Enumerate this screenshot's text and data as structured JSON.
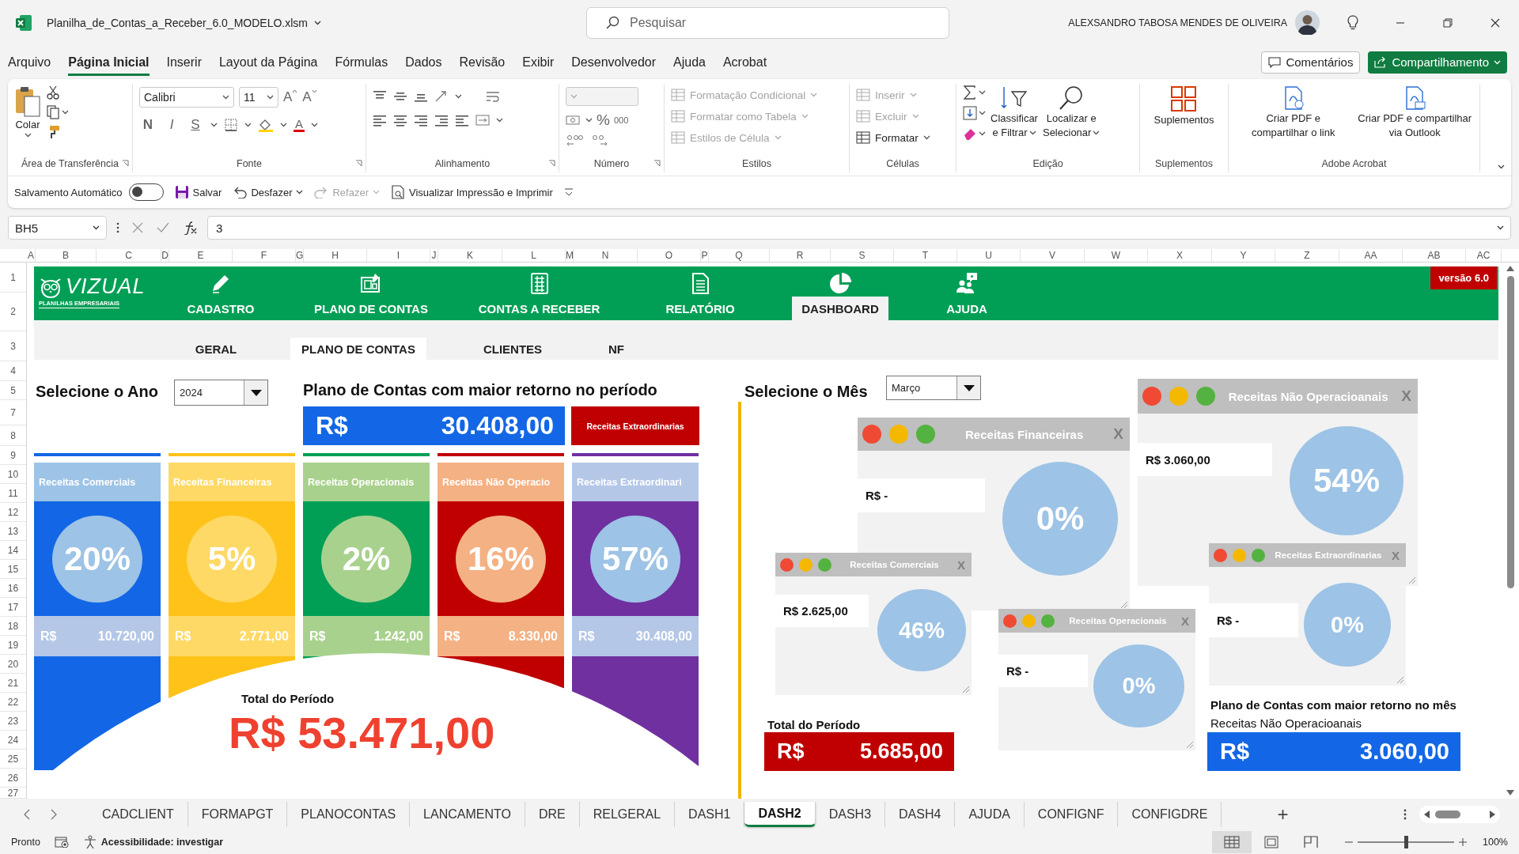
{
  "title_bar": {
    "filename": "Planilha_de_Contas_a_Receber_6.0_MODELO.xlsm",
    "search_placeholder": "Pesquisar",
    "user": "ALEXSANDRO TABOSA MENDES DE OLIVEIRA"
  },
  "menu": [
    {
      "label": "Arquivo",
      "selected": false
    },
    {
      "label": "Página Inicial",
      "selected": true
    },
    {
      "label": "Inserir",
      "selected": false
    },
    {
      "label": "Layout da Página",
      "selected": false
    },
    {
      "label": "Fórmulas",
      "selected": false
    },
    {
      "label": "Dados",
      "selected": false
    },
    {
      "label": "Revisão",
      "selected": false
    },
    {
      "label": "Exibir",
      "selected": false
    },
    {
      "label": "Desenvolvedor",
      "selected": false
    },
    {
      "label": "Ajuda",
      "selected": false
    },
    {
      "label": "Acrobat",
      "selected": false
    }
  ],
  "comments_button": "Comentários",
  "share_button": "Compartilhamento",
  "ribbon": [
    {
      "kind": "clipboard",
      "label": "Área de Transferência",
      "launcher": true,
      "paste": "Colar"
    },
    {
      "kind": "font",
      "label": "Fonte",
      "launcher": true,
      "font": "Calibri",
      "size": "11",
      "grow": "A",
      "shrink": "A",
      "styles": [
        "N",
        "I",
        "S"
      ],
      "color_letter": "A"
    },
    {
      "kind": "alignment",
      "label": "Alinhamento",
      "launcher": true
    },
    {
      "kind": "number",
      "label": "Número",
      "launcher": true,
      "percent": "%",
      "thousands": "000"
    },
    {
      "kind": "styles",
      "label": "Estilos",
      "launcher": false,
      "items": [
        {
          "label": "Formatação Condicional",
          "disabled": true
        },
        {
          "label": "Formatar como Tabela",
          "disabled": true
        },
        {
          "label": "Estilos de Célula",
          "disabled": true
        }
      ]
    },
    {
      "kind": "cells",
      "label": "Células",
      "launcher": false,
      "items": [
        {
          "label": "Inserir",
          "disabled": true
        },
        {
          "label": "Excluir",
          "disabled": true
        },
        {
          "label": "Formatar",
          "disabled": false
        }
      ]
    },
    {
      "kind": "editing",
      "label": "Edição",
      "launcher": false,
      "items": [
        {
          "lines": [
            "Classificar",
            "e Filtrar"
          ]
        },
        {
          "lines": [
            "Localizar e",
            "Selecionar"
          ]
        }
      ]
    },
    {
      "kind": "addins",
      "label": "Suplementos",
      "launcher": false,
      "items": [
        {
          "lines": [
            "Suplementos"
          ]
        }
      ]
    },
    {
      "kind": "acrobat",
      "label": "Adobe Acrobat",
      "launcher": false,
      "items": [
        {
          "lines": [
            "Criar PDF e",
            "compartilhar o link"
          ]
        },
        {
          "lines": [
            "Criar PDF e compartilhar",
            "via Outlook"
          ]
        }
      ]
    }
  ],
  "quick_access": {
    "autosave": {
      "label": "Salvamento Automático",
      "on": false
    },
    "items": [
      {
        "kind": "save",
        "label": "Salvar",
        "disabled": false
      },
      {
        "kind": "undo",
        "label": "Desfazer",
        "disabled": false
      },
      {
        "kind": "redo",
        "label": "Refazer",
        "disabled": true
      },
      {
        "kind": "print",
        "label": "Visualizar Impressão e Imprimir",
        "disabled": false
      }
    ]
  },
  "formula_bar": {
    "name_box": "BH5",
    "value": "3"
  },
  "columns": [
    "A",
    "B",
    "C",
    "D",
    "E",
    "F",
    "G",
    "H",
    "I",
    "J",
    "K",
    "L",
    "M",
    "N",
    "O",
    "P",
    "Q",
    "R",
    "S",
    "T",
    "U",
    "V",
    "W",
    "X",
    "Y",
    "Z",
    "AA",
    "AB",
    "AC"
  ],
  "rows": [
    "1",
    "2",
    "3",
    "4",
    "5",
    "7",
    "8",
    "9",
    "10",
    "11",
    "12",
    "13",
    "14",
    "15",
    "16",
    "17",
    "18",
    "19",
    "20",
    "21",
    "22",
    "23",
    "24",
    "25",
    "26",
    "27"
  ],
  "dashboard": {
    "logo": {
      "name": "VIZUAL",
      "tagline": "PLANILHAS EMPRESARIAIS"
    },
    "nav": [
      {
        "label": "CADASTRO",
        "kind": "pencil",
        "selected": false
      },
      {
        "label": "PLANO DE CONTAS",
        "kind": "blueprint",
        "selected": false
      },
      {
        "label": "CONTAS A RECEBER",
        "kind": "abacus",
        "selected": false
      },
      {
        "label": "RELATÓRIO",
        "kind": "document",
        "selected": false
      },
      {
        "label": "DASHBOARD",
        "kind": "pie",
        "selected": true
      },
      {
        "label": "AJUDA",
        "kind": "help",
        "selected": false
      }
    ],
    "version": "versão 6.0",
    "subtabs": [
      {
        "label": "GERAL",
        "selected": false
      },
      {
        "label": "PLANO DE CONTAS",
        "selected": true
      },
      {
        "label": "CLIENTES",
        "selected": false
      },
      {
        "label": "NF",
        "selected": false
      }
    ],
    "year": {
      "label": "Selecione o Ano",
      "value": "2024"
    },
    "top_account": {
      "title": "Plano de Contas com maior retorno no período",
      "currency": "R$",
      "amount": "30.408,00",
      "name": "Receitas Extraordinarias"
    },
    "cards": [
      {
        "title": "Receitas Comerciais",
        "percent": "20%",
        "currency": "R$",
        "amount": "10.720,00",
        "color": "#1367e6"
      },
      {
        "title": "Receitas Financeiras",
        "percent": "5%",
        "currency": "R$",
        "amount": "2.771,00",
        "color": "#fec219"
      },
      {
        "title": "Receitas Operacionais",
        "percent": "2%",
        "currency": "R$",
        "amount": "1.242,00",
        "color": "#009f55"
      },
      {
        "title": "Receitas Não Operacio",
        "percent": "16%",
        "currency": "R$",
        "amount": "8.330,00",
        "color": "#c00000"
      },
      {
        "title": "Receitas Extraordinari",
        "percent": "57%",
        "currency": "R$",
        "amount": "30.408,00",
        "color": "#7030a0"
      }
    ],
    "total": {
      "label": "Total do Período",
      "value": "R$ 53.471,00"
    },
    "month": {
      "label": "Selecione o Mês",
      "value": "Março"
    },
    "windows": [
      {
        "title": "Receitas Não Operacioanais",
        "close": "X",
        "amount": "R$ 3.060,00",
        "percent": "54%"
      },
      {
        "title": "Receitas Financeiras",
        "close": "X",
        "amount": "R$ -",
        "percent": "0%"
      },
      {
        "title": "Receitas Comerciais",
        "close": "X",
        "amount": "R$ 2.625,00",
        "percent": "46%"
      },
      {
        "title": "Receitas Operacionais",
        "close": "X",
        "amount": "R$ -",
        "percent": "0%"
      },
      {
        "title": "Receitas Extraordinarias",
        "close": "X",
        "amount": "R$ -",
        "percent": "0%"
      }
    ],
    "month_total": {
      "label": "Total do Período",
      "currency": "R$",
      "amount": "5.685,00"
    },
    "month_top": {
      "title": "Plano de Contas com maior retorno no mês",
      "name": "Receitas Não Operacioanais",
      "currency": "R$",
      "amount": "3.060,00"
    }
  },
  "sheet_tabs": [
    {
      "label": "CADCLIENT",
      "selected": false
    },
    {
      "label": "FORMAPGT",
      "selected": false
    },
    {
      "label": "PLANOCONTAS",
      "selected": false
    },
    {
      "label": "LANCAMENTO",
      "selected": false
    },
    {
      "label": "DRE",
      "selected": false
    },
    {
      "label": "RELGERAL",
      "selected": false
    },
    {
      "label": "DASH1",
      "selected": false
    },
    {
      "label": "DASH2",
      "selected": true
    },
    {
      "label": "DASH3",
      "selected": false
    },
    {
      "label": "DASH4",
      "selected": false
    },
    {
      "label": "AJUDA",
      "selected": false
    },
    {
      "label": "CONFIGNF",
      "selected": false
    },
    {
      "label": "CONFIGDRE",
      "selected": false
    }
  ],
  "add_sheet": "+",
  "status_bar": {
    "ready": "Pronto",
    "accessibility": "Acessibilidade: investigar",
    "views": [
      {
        "kind": "normal",
        "selected": true
      },
      {
        "kind": "layout",
        "selected": false
      },
      {
        "kind": "pagebreak",
        "selected": false
      }
    ],
    "zoom": {
      "label": "100%",
      "level": 0.5
    }
  }
}
